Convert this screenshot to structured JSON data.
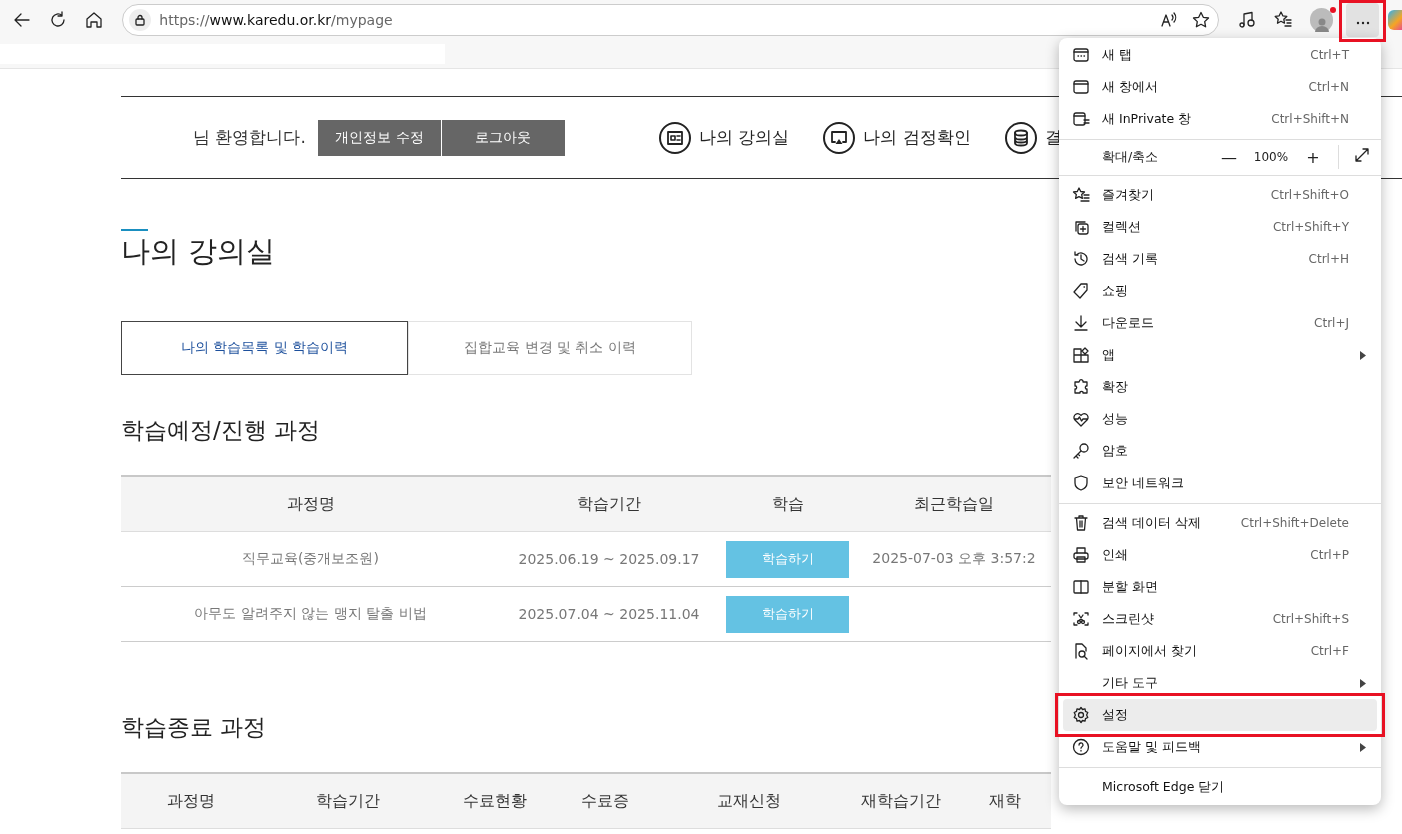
{
  "toolbar": {
    "url": {
      "scheme": "https://",
      "host": "www.karedu.or.kr",
      "path": "/mypage"
    },
    "profile": {
      "notification": true
    },
    "more_button": {
      "annotated": true
    }
  },
  "page": {
    "welcome": "님 환영합니다.",
    "account_buttons": [
      "개인정보 수정",
      "로그아웃"
    ],
    "nav": [
      {
        "label": "나의 강의실",
        "kind": "board"
      },
      {
        "label": "나의 검정확인",
        "kind": "monitor"
      },
      {
        "label": "결",
        "kind": "coins"
      }
    ],
    "title": "나의 강의실",
    "tabs": [
      {
        "label": "나의 학습목록 및 학습이력",
        "selected": true
      },
      {
        "label": "집합교육 변경 및 취소 이력",
        "selected": false
      }
    ],
    "current": {
      "heading": "학습예정/진행 과정",
      "columns": [
        "과정명",
        "학습기간",
        "학습",
        "최근학습일"
      ],
      "rows": [
        {
          "course": "직무교육(중개보조원)",
          "period": "2025.06.19 ~ 2025.09.17",
          "action": "학습하기",
          "recent": "2025-07-03 오후 3:57:2"
        },
        {
          "course": "아무도 알려주지 않는 맹지 탈출 비법",
          "period": "2025.07.04 ~ 2025.11.04",
          "action": "학습하기"
        }
      ]
    },
    "finished": {
      "heading": "학습종료 과정",
      "columns": [
        "과정명",
        "학습기간",
        "수료현황",
        "수료증",
        "교재신청",
        "재학습기간",
        "재학"
      ]
    }
  },
  "menu": {
    "items": [
      {
        "kind": "item",
        "label": "새 탭",
        "shortcut": "Ctrl+T",
        "selected": false
      },
      {
        "kind": "item",
        "label": "새 창에서",
        "shortcut": "Ctrl+N",
        "selected": false
      },
      {
        "kind": "item",
        "label": "새 InPrivate 창",
        "shortcut": "Ctrl+Shift+N",
        "selected": false
      },
      {
        "kind": "separator"
      },
      {
        "kind": "zoom",
        "label": "확대/축소",
        "value": "100%",
        "minus": "—",
        "plus": "+"
      },
      {
        "kind": "separator"
      },
      {
        "kind": "item",
        "label": "즐겨찾기",
        "shortcut": "Ctrl+Shift+O",
        "selected": false
      },
      {
        "kind": "item",
        "label": "컬렉션",
        "shortcut": "Ctrl+Shift+Y",
        "selected": false
      },
      {
        "kind": "item",
        "label": "검색 기록",
        "shortcut": "Ctrl+H",
        "selected": false
      },
      {
        "kind": "item",
        "label": "쇼핑",
        "selected": false
      },
      {
        "kind": "item",
        "label": "다운로드",
        "shortcut": "Ctrl+J",
        "selected": false
      },
      {
        "kind": "item",
        "label": "앱",
        "submenu": true,
        "selected": false
      },
      {
        "kind": "item",
        "label": "확장",
        "selected": false
      },
      {
        "kind": "item",
        "label": "성능",
        "selected": false
      },
      {
        "kind": "item",
        "label": "암호",
        "selected": false
      },
      {
        "kind": "item",
        "label": "보안 네트워크",
        "selected": false
      },
      {
        "kind": "separator"
      },
      {
        "kind": "item",
        "label": "검색 데이터 삭제",
        "shortcut": "Ctrl+Shift+Delete",
        "selected": false
      },
      {
        "kind": "item",
        "label": "인쇄",
        "shortcut": "Ctrl+P",
        "selected": false
      },
      {
        "kind": "item",
        "label": "분할 화면",
        "selected": false
      },
      {
        "kind": "item",
        "label": "스크린샷",
        "shortcut": "Ctrl+Shift+S",
        "selected": false
      },
      {
        "kind": "item",
        "label": "페이지에서 찾기",
        "shortcut": "Ctrl+F",
        "selected": false
      },
      {
        "kind": "item",
        "label": "기타 도구",
        "submenu": true,
        "selected": false
      },
      {
        "kind": "item",
        "label": "설정",
        "selected": true,
        "annotated": true
      },
      {
        "kind": "item",
        "label": "도움말 및 피드백",
        "submenu": true,
        "selected": false
      },
      {
        "kind": "separator"
      },
      {
        "kind": "item",
        "label": "Microsoft Edge 닫기",
        "selected": false
      }
    ]
  }
}
